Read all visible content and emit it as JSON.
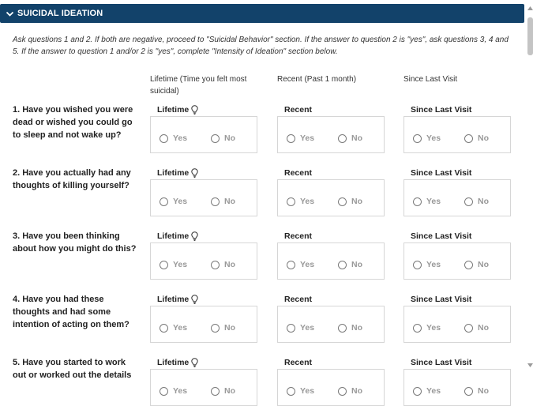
{
  "section": {
    "title": "SUICIDAL IDEATION"
  },
  "instructions": "Ask questions 1 and 2. If both are negative, proceed to \"Suicidal Behavior\" section. If the answer to question 2 is \"yes\", ask questions 3, 4 and 5. If the answer to question 1 and/or 2 is \"yes\", complete \"Intensity of Ideation\" section below.",
  "columns": {
    "lifetime": "Lifetime (Time you felt most suicidal)",
    "recent": "Recent (Past 1 month)",
    "since": "Since Last Visit"
  },
  "field_labels": {
    "lifetime": "Lifetime",
    "recent": "Recent",
    "since": "Since Last Visit"
  },
  "options": {
    "yes": "Yes",
    "no": "No"
  },
  "questions": [
    {
      "text": "1. Have you wished you were dead or wished you could go to sleep and not wake up?"
    },
    {
      "text": "2. Have you actually had any thoughts of killing yourself?"
    },
    {
      "text": "3. Have you been thinking about how you might do this?"
    },
    {
      "text": "4. Have you had these thoughts and had some intention of acting on them?"
    },
    {
      "text": "5. Have you started to work out or worked out the details"
    }
  ],
  "icons": {
    "collapse": "chevron-down-icon",
    "info": "lightbulb-icon"
  },
  "colors": {
    "header_bg": "#12426a",
    "header_text": "#ffffff"
  }
}
